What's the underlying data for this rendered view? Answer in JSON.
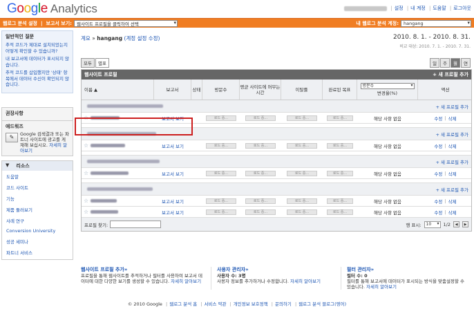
{
  "header": {
    "logo_google": "Google",
    "logo_analytics": "Analytics",
    "links": [
      "설정",
      "내 계정",
      "도움말",
      "로그아웃"
    ]
  },
  "orangebar": {
    "left_label": "웹로그 분석 설정",
    "view_label": "보고서 보기:",
    "view_select": "웹사이트 프로필을 클릭하여 선택",
    "account_label": "내 웹로그 분석 계정:",
    "account_select": "hangang"
  },
  "sidebar": {
    "faq_title": "일반적인 질문",
    "faq_items": [
      "추적 코드가 제대로 설치되었는지 어떻게 확인할 수 있습니까?",
      "내 보고서에 데이터가 표시되지 않습니다.",
      "추적 코드를 삽입했지만 '상태' 항목에서 데이터 수신이 확인되지 않습니다."
    ],
    "recommend_title": "권장사항",
    "adwords_title": "애드워즈",
    "adwords_text": "Google 검색결과 또는 파트너 사이트에 광고를 게재해 보십시오.",
    "adwords_link": "자세히 알아보기",
    "resources_title": "리소스",
    "resources": [
      "도움말",
      "코드 사이트",
      "기능",
      "제품 둘러보기",
      "사례 연구",
      "Conversion University",
      "성공 세미나",
      "파트너 서비스"
    ]
  },
  "main": {
    "breadcrumb_home": "계요",
    "breadcrumb_arrow": "»",
    "breadcrumb_account": "hangang",
    "breadcrumb_edit": "(계정 설정 수정)",
    "date_range": "2010. 8. 1. - 2010. 8. 31.",
    "compare_range": "비교 대상: 2010. 7. 1. - 2010. 7. 31.",
    "view_all": "모두",
    "view_star": "별표",
    "periods": [
      "일",
      "주",
      "월",
      "연"
    ],
    "table_title": "웹사이트 프로필",
    "add_profile": "+ 새 프로필 추가",
    "columns": {
      "name": "이름 ▲",
      "report": "보고서",
      "status": "상태",
      "visits": "방문수",
      "avg_time": "평균 사이트에 머무는 시간",
      "bounce": "이탈률",
      "goal": "완료된 목표",
      "metric_select": "방문수",
      "change": "변경율(%)",
      "action": "액션"
    },
    "row_add": "+ 새 프로필 추가",
    "report_link": "보고서 보기",
    "na_text": "해당 사항 없음",
    "edit": "수정",
    "delete": "삭제",
    "bar_text": "로드 중...",
    "find_label": "프로필 찾기:",
    "show_rows_label": "행 표시:",
    "show_rows_value": "10",
    "pagination": "1/2"
  },
  "promo": [
    {
      "title": "웹사이트 프로필 추가»",
      "text": "프로필을 통해 웹사이트를 추적하거나 필터를 사용하여 보고서 데이터에 대한 다양한 보기를 생성할 수 있습니다.",
      "link": "자세히 알아보기"
    },
    {
      "title": "사용자 관리자»",
      "bold": "사용자 수: 3명",
      "text": "사용자 정보를 추가하거나 수정합니다.",
      "link": "자세히 알아보기"
    },
    {
      "title": "필터 관리자»",
      "bold": "필터 수: 0",
      "text": "필터를 통해 보고서에 데이터가 표시되는 방식을 맞춤설정할 수 있습니다.",
      "link": "자세히 알아보기"
    }
  ],
  "footer": {
    "copyright": "© 2010 Google",
    "links": [
      "웹로그 분석 홈",
      "서비스 약관",
      "개인정보 보호정책",
      "문의하기",
      "웹로그 분석 블로그(영어)"
    ]
  }
}
